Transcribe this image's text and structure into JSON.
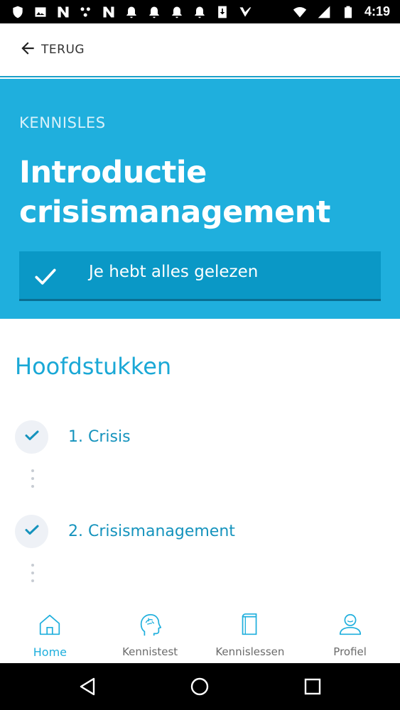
{
  "status_bar": {
    "time": "4:19",
    "left_icons": [
      "shield-icon",
      "image-icon",
      "n-app-icon",
      "dots-app-icon",
      "n-app-icon-2",
      "bell-icon",
      "bell-icon-2",
      "bell-icon-3",
      "bell-icon-4",
      "download-icon",
      "check-app-icon"
    ],
    "right_icons": [
      "wifi-icon",
      "signal-icon",
      "battery-icon"
    ]
  },
  "topbar": {
    "back_label": "TERUG"
  },
  "hero": {
    "kicker": "KENNISLES",
    "title": "Introductie crisismanagement",
    "read_status": "Je hebt alles gelezen",
    "background": "#1fafdd",
    "banner_color": "#0a98c6"
  },
  "chapters": {
    "title": "Hoofdstukken",
    "items": [
      {
        "label": "1. Crisis",
        "done": true
      },
      {
        "label": "2. Crisismanagement",
        "done": true
      }
    ]
  },
  "bottom_nav": {
    "items": [
      {
        "label": "Home",
        "icon": "home-icon",
        "active": true
      },
      {
        "label": "Kennistest",
        "icon": "brain-head-icon",
        "active": false
      },
      {
        "label": "Kennislessen",
        "icon": "book-icon",
        "active": false
      },
      {
        "label": "Profiel",
        "icon": "user-icon",
        "active": false
      }
    ]
  },
  "colors": {
    "accent": "#1fafdd",
    "accent_dark": "#1593bd",
    "check": "#1593bd"
  }
}
